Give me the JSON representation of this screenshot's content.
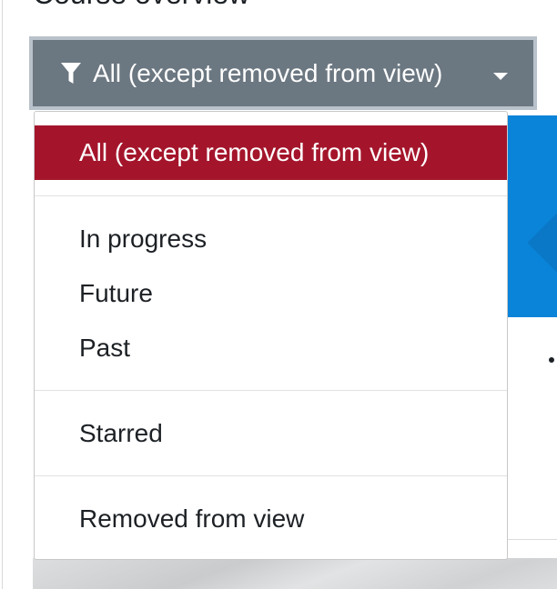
{
  "section": {
    "title": "Course overview"
  },
  "filter": {
    "selected_label": "All (except removed from view)",
    "icon": "filter-icon",
    "caret_icon": "caret-down-icon",
    "colors": {
      "toggle_background": "#6b7781",
      "toggle_border": "#b9c2ca",
      "active_item": "#a4152b"
    }
  },
  "menu": {
    "items": [
      {
        "label": "All (except removed from view)",
        "active": true
      },
      {
        "label": "In progress",
        "active": false
      },
      {
        "label": "Future",
        "active": false
      },
      {
        "label": "Past",
        "active": false
      },
      {
        "label": "Starred",
        "active": false
      },
      {
        "label": "Removed from view",
        "active": false
      }
    ]
  }
}
